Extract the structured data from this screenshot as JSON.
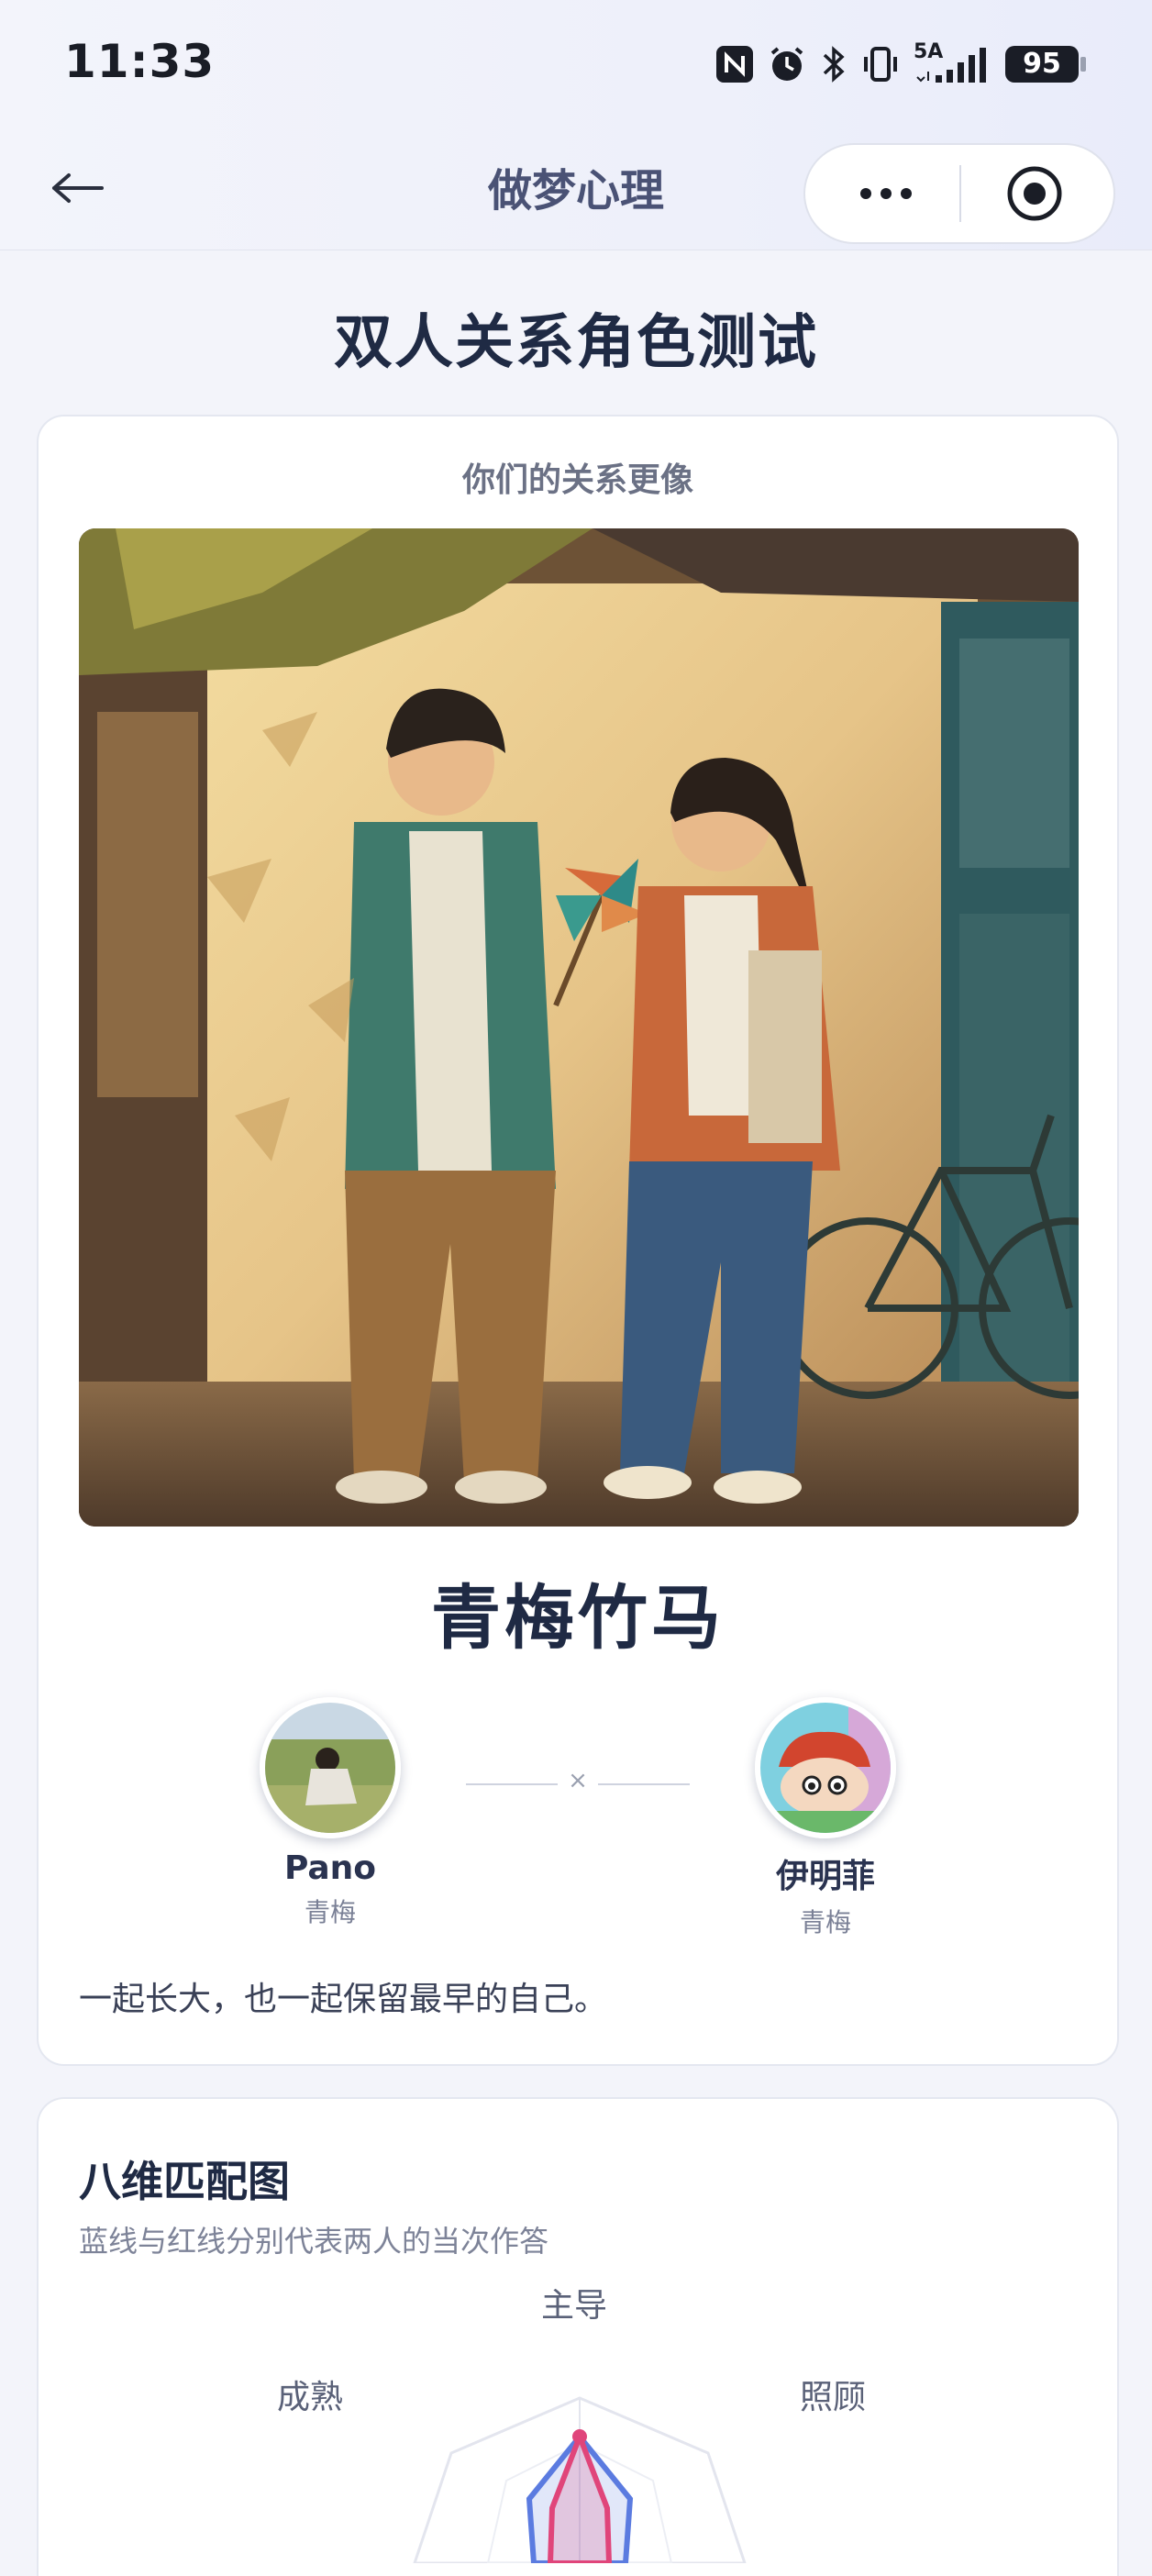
{
  "status_bar": {
    "time": "11:33",
    "network": "5A",
    "battery": "95",
    "icons": [
      "nfc-icon",
      "alarm-icon",
      "bluetooth-icon",
      "vibrate-icon",
      "signal-icon",
      "battery-icon"
    ]
  },
  "nav": {
    "title": "做梦心理",
    "back_icon": "arrow-left-icon",
    "more_icon": "more-dots-icon",
    "close_icon": "target-close-icon"
  },
  "page": {
    "title": "双人关系角色测试"
  },
  "result": {
    "subtitle": "你们的关系更像",
    "image_desc_icon": "illustration-childhood-sweethearts",
    "name": "青梅竹马",
    "connector_symbol": "×",
    "person_a": {
      "name": "Pano",
      "role": "青梅"
    },
    "person_b": {
      "name": "伊明菲",
      "role": "青梅"
    },
    "description": "一起长大，也一起保留最早的自己。"
  },
  "chart_section": {
    "title": "八维匹配图",
    "subtitle": "蓝线与红线分别代表两人的当次作答",
    "axis_labels": [
      "主导",
      "照顾",
      "成熟"
    ]
  },
  "colors": {
    "accent_dark": "#1f2a44",
    "nav_title": "#4a5275",
    "series_blue": "#5b7be0",
    "series_red": "#e0457a"
  }
}
